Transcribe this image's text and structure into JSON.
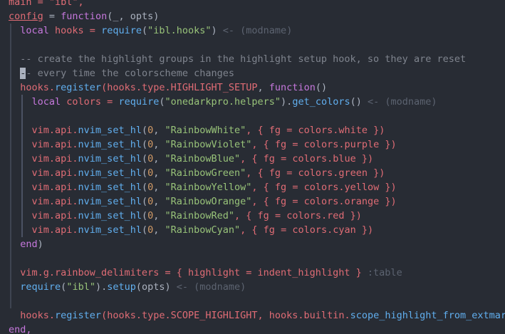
{
  "colors": {
    "background": "#282c34",
    "keyword": "#c678dd",
    "function": "#61afef",
    "string": "#98c379",
    "number": "#d19a66",
    "variable": "#e06c75",
    "comment": "#7f848e",
    "type_hint": "#5c6370",
    "bracket": "#e5c07b"
  },
  "lines": [
    [
      {
        "t": "main = \"ibl\",",
        "c": "var"
      }
    ],
    [
      {
        "t": "config",
        "c": "cfg"
      },
      {
        "t": " = ",
        "c": ""
      },
      {
        "t": "function",
        "c": "kw"
      },
      {
        "t": "(_, opts)",
        "c": ""
      }
    ],
    [
      {
        "t": "  ",
        "c": ""
      },
      {
        "t": "local",
        "c": "kw"
      },
      {
        "t": " hooks = ",
        "c": "var"
      },
      {
        "t": "require",
        "c": "fn"
      },
      {
        "t": "(",
        "c": ""
      },
      {
        "t": "\"ibl.hooks\"",
        "c": "str"
      },
      {
        "t": ")",
        "c": ""
      },
      {
        "t": " <- (modname)",
        "c": "hint"
      }
    ],
    [
      {
        "t": "",
        "c": ""
      }
    ],
    [
      {
        "t": "  -- create the highlight groups in the highlight setup hook, so they are reset",
        "c": "cmt"
      }
    ],
    [
      {
        "t": "  ",
        "c": ""
      },
      {
        "t": "-",
        "c": "cursor"
      },
      {
        "t": "- every time the colorscheme changes",
        "c": "cmt"
      }
    ],
    [
      {
        "t": "  hooks.",
        "c": "var"
      },
      {
        "t": "register",
        "c": "fn"
      },
      {
        "t": "(hooks.type.",
        "c": "var"
      },
      {
        "t": "HIGHLIGHT_SETUP",
        "c": "var"
      },
      {
        "t": ", ",
        "c": ""
      },
      {
        "t": "function",
        "c": "kw"
      },
      {
        "t": "()",
        "c": ""
      }
    ],
    [
      {
        "t": "    ",
        "c": ""
      },
      {
        "t": "local",
        "c": "kw"
      },
      {
        "t": " colors = ",
        "c": "var"
      },
      {
        "t": "require",
        "c": "fn"
      },
      {
        "t": "(",
        "c": ""
      },
      {
        "t": "\"onedarkpro.helpers\"",
        "c": "str"
      },
      {
        "t": ").",
        "c": ""
      },
      {
        "t": "get_colors",
        "c": "fn"
      },
      {
        "t": "()",
        "c": ""
      },
      {
        "t": " <- (modname)",
        "c": "hint"
      }
    ],
    [
      {
        "t": "",
        "c": ""
      }
    ],
    [
      {
        "t": "    vim.api.",
        "c": "var"
      },
      {
        "t": "nvim_set_hl",
        "c": "fn"
      },
      {
        "t": "(",
        "c": ""
      },
      {
        "t": "0",
        "c": "num"
      },
      {
        "t": ", ",
        "c": ""
      },
      {
        "t": "\"RainbowWhite\"",
        "c": "str"
      },
      {
        "t": ", { fg = colors.white })",
        "c": "var"
      }
    ],
    [
      {
        "t": "    vim.api.",
        "c": "var"
      },
      {
        "t": "nvim_set_hl",
        "c": "fn"
      },
      {
        "t": "(",
        "c": ""
      },
      {
        "t": "0",
        "c": "num"
      },
      {
        "t": ", ",
        "c": ""
      },
      {
        "t": "\"RainbowViolet\"",
        "c": "str"
      },
      {
        "t": ", { fg = colors.purple })",
        "c": "var"
      }
    ],
    [
      {
        "t": "    vim.api.",
        "c": "var"
      },
      {
        "t": "nvim_set_hl",
        "c": "fn"
      },
      {
        "t": "(",
        "c": ""
      },
      {
        "t": "0",
        "c": "num"
      },
      {
        "t": ", ",
        "c": ""
      },
      {
        "t": "\"RainbowBlue\"",
        "c": "str"
      },
      {
        "t": ", { fg = colors.blue })",
        "c": "var"
      }
    ],
    [
      {
        "t": "    vim.api.",
        "c": "var"
      },
      {
        "t": "nvim_set_hl",
        "c": "fn"
      },
      {
        "t": "(",
        "c": ""
      },
      {
        "t": "0",
        "c": "num"
      },
      {
        "t": ", ",
        "c": ""
      },
      {
        "t": "\"RainbowGreen\"",
        "c": "str"
      },
      {
        "t": ", { fg = colors.green })",
        "c": "var"
      }
    ],
    [
      {
        "t": "    vim.api.",
        "c": "var"
      },
      {
        "t": "nvim_set_hl",
        "c": "fn"
      },
      {
        "t": "(",
        "c": ""
      },
      {
        "t": "0",
        "c": "num"
      },
      {
        "t": ", ",
        "c": ""
      },
      {
        "t": "\"RainbowYellow\"",
        "c": "str"
      },
      {
        "t": ", { fg = colors.yellow })",
        "c": "var"
      }
    ],
    [
      {
        "t": "    vim.api.",
        "c": "var"
      },
      {
        "t": "nvim_set_hl",
        "c": "fn"
      },
      {
        "t": "(",
        "c": ""
      },
      {
        "t": "0",
        "c": "num"
      },
      {
        "t": ", ",
        "c": ""
      },
      {
        "t": "\"RainbowOrange\"",
        "c": "str"
      },
      {
        "t": ", { fg = colors.orange })",
        "c": "var"
      }
    ],
    [
      {
        "t": "    vim.api.",
        "c": "var"
      },
      {
        "t": "nvim_set_hl",
        "c": "fn"
      },
      {
        "t": "(",
        "c": ""
      },
      {
        "t": "0",
        "c": "num"
      },
      {
        "t": ", ",
        "c": ""
      },
      {
        "t": "\"RainbowRed\"",
        "c": "str"
      },
      {
        "t": ", { fg = colors.red })",
        "c": "var"
      }
    ],
    [
      {
        "t": "    vim.api.",
        "c": "var"
      },
      {
        "t": "nvim_set_hl",
        "c": "fn"
      },
      {
        "t": "(",
        "c": ""
      },
      {
        "t": "0",
        "c": "num"
      },
      {
        "t": ", ",
        "c": ""
      },
      {
        "t": "\"RainbowCyan\"",
        "c": "str"
      },
      {
        "t": ", { fg = colors.cyan })",
        "c": "var"
      }
    ],
    [
      {
        "t": "  ",
        "c": ""
      },
      {
        "t": "end",
        "c": "kw"
      },
      {
        "t": ")",
        "c": ""
      }
    ],
    [
      {
        "t": "",
        "c": ""
      }
    ],
    [
      {
        "t": "  vim.g.rainbow_delimiters = { highlight = indent_highlight }",
        "c": "var"
      },
      {
        "t": " :table",
        "c": "hint"
      }
    ],
    [
      {
        "t": "  ",
        "c": ""
      },
      {
        "t": "require",
        "c": "fn"
      },
      {
        "t": "(",
        "c": ""
      },
      {
        "t": "\"ibl\"",
        "c": "str"
      },
      {
        "t": ").",
        "c": ""
      },
      {
        "t": "setup",
        "c": "fn"
      },
      {
        "t": "(opts)",
        "c": ""
      },
      {
        "t": " <- (modname)",
        "c": "hint"
      }
    ],
    [
      {
        "t": "",
        "c": ""
      }
    ],
    [
      {
        "t": "  hooks.",
        "c": "var"
      },
      {
        "t": "register",
        "c": "fn"
      },
      {
        "t": "(hooks.type.",
        "c": "var"
      },
      {
        "t": "SCOPE_HIGHLIGHT",
        "c": "var"
      },
      {
        "t": ", hooks.builtin.",
        "c": "var"
      },
      {
        "t": "scope_highlight_from_extmark",
        "c": "fn"
      },
      {
        "t": ")",
        "c": ""
      }
    ],
    [
      {
        "t": "end,",
        "c": "kw"
      }
    ]
  ]
}
